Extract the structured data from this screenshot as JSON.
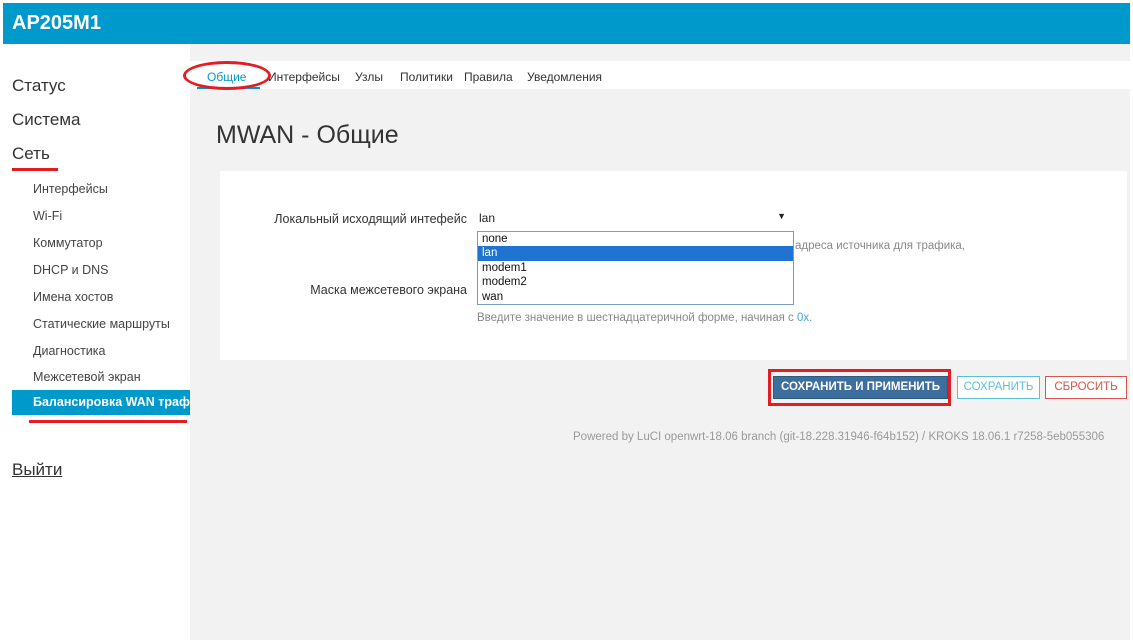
{
  "app": {
    "title": "AP205M1"
  },
  "sidebar": {
    "status": "Статус",
    "system": "Система",
    "network": "Сеть",
    "items": [
      "Интерфейсы",
      "Wi-Fi",
      "Коммутатор",
      "DHCP и DNS",
      "Имена хостов",
      "Статические маршруты",
      "Диагностика",
      "Межсетевой экран"
    ],
    "active_item": "Балансировка WAN трафика",
    "logout": "Выйти"
  },
  "tabs": {
    "items": [
      "Общие",
      "Интерфейсы",
      "Узлы",
      "Политики",
      "Правила",
      "Уведомления"
    ],
    "active": "Общие"
  },
  "page": {
    "title": "MWAN - Общие"
  },
  "form": {
    "local_source_label": "Локальный исходящий интефейс",
    "local_source_value": "lan",
    "options": [
      "none",
      "lan",
      "modem1",
      "modem2",
      "wan"
    ],
    "local_source_desc": "адреса источника для трафика,",
    "firewall_mask_label": "Маска межсетевого экрана",
    "firewall_mask_desc": "Введите значение в шестнадцатеричной форме, начиная с",
    "firewall_mask_desc_link": "0x."
  },
  "buttons": {
    "apply": "СОХРАНИТЬ И ПРИМЕНИТЬ",
    "save": "СОХРАНИТЬ",
    "reset": "СБРОСИТЬ"
  },
  "footer": {
    "text": "Powered by LuCI openwrt-18.06 branch (git-18.228.31946-f64b152) / KROKS 18.06.1 r7258-5eb055306"
  },
  "colors": {
    "accent": "#0099cc",
    "highlight": "#e21d23",
    "apply": "#3d6e9e"
  }
}
